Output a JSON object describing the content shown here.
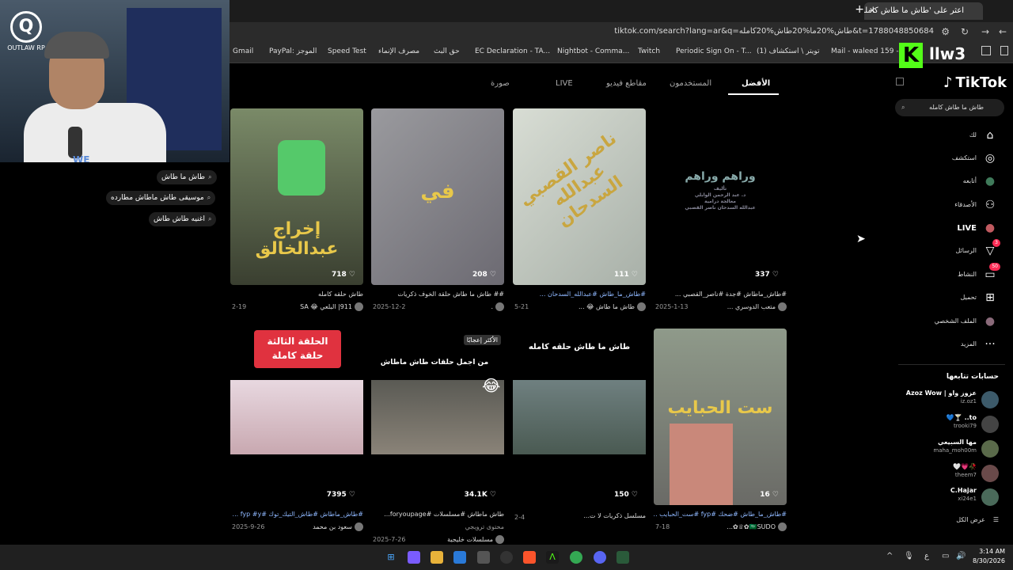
{
  "browser": {
    "tab_title": "اعثر على 'طاش ما طاش كامله' ع",
    "new_tab": "+",
    "tab_close": "×",
    "url": "tiktok.com/search?lang=ar&q=طاش%20ما%20طاش%20كامله&t=1788048850684",
    "bookmarks": [
      "Gmail",
      "PayPal: الموجز",
      "Speed Test",
      "مصرف الإنماء",
      "حق البث",
      "EC Declaration - TA...",
      "Nightbot - Comma...",
      "Twitch",
      "Periodic Sign On - T...",
      "تويتر \\ استكشاف (1)",
      "Mail - waleed 159 -..."
    ]
  },
  "overlay": {
    "kick_k": "K",
    "kick_text": "llw3",
    "logo_letter": "Q",
    "logo_text": "OUTLAW RP",
    "we_text": "WE"
  },
  "suggestions": [
    "طاش ما طاش",
    "موسيقى طاش ماطاش مطارده",
    "اغنيه طاش طاش"
  ],
  "tabs": [
    "الأفضل",
    "المستخدمون",
    "مقاطع فيديو",
    "LIVE",
    "صورة"
  ],
  "videos": [
    {
      "likes": "337",
      "caption": "#طاش_ماطاش #جدة #ناصر_القصبي ...",
      "author": "متعب الدوسري ...",
      "date": "2025-1-13",
      "title": "وراهم وراهم",
      "sub": "تأليف\nد. عبد الرحمن الوابلي\nمعالجة درامية\nعبدالله السدحان   ناصر القصبي"
    },
    {
      "likes": "111",
      "caption": "#طاش_ما_طاش #عبدالله_السدحان ...",
      "author": "طاش ما طاش 😂 ...",
      "date": "5-21",
      "title": "ناصر القصبي عبدالله السدحان"
    },
    {
      "likes": "208",
      "caption": "## طاش ما طاش حلقة الخوف ذكريات",
      "author": ".",
      "date": "2025-12-2",
      "title": "في"
    },
    {
      "likes": "718",
      "caption": "طاش حلقه كامله",
      "author": "911| البلعي 😂 SA",
      "date": "2-19",
      "title": "إخراج عبدالخالق"
    },
    {
      "likes": "16",
      "caption": "#طاش_ما_طاش #ضحك #fyp #ست_الحبايب ...",
      "author": "🇸🇦SUDO✿♕✿...",
      "date": "7-18",
      "title": "ست الحبايب"
    },
    {
      "likes": "150",
      "caption": "مسلسل ذكريات لا ت...",
      "author": "",
      "date": "2-4",
      "title": "طاش ما طاش حلقه كامله"
    },
    {
      "likes": "34.1K",
      "caption": "طاش ماطاش #مسلسلات #foryoupage...",
      "author": "محتوى ترويجي",
      "author2": "مسلسلات خليجية",
      "date": "2025-7-26",
      "badge": "الأكثر إعجابًا",
      "title": "من اجمل حلقات طاش ماطاش"
    },
    {
      "likes": "7395",
      "caption": "#طاش_ماطاش #طاش_التيك_توك #fyp #y ...",
      "author": "سعود بن محمد",
      "date": "2025-9-26",
      "title": "الحلقة الثالثة\nحلقة كاملة"
    }
  ],
  "sidebar": {
    "brand": "TikTok",
    "search_value": "طاش ما طاش كامله",
    "nav": [
      {
        "label": "لك",
        "icon": "⌂"
      },
      {
        "label": "استكشف",
        "icon": "◎"
      },
      {
        "label": "أتابعه",
        "icon": "●"
      },
      {
        "label": "الأصدقاء",
        "icon": "⚇"
      },
      {
        "label": "LIVE",
        "icon": "●"
      },
      {
        "label": "الرسائل",
        "icon": "▽",
        "badge": "3"
      },
      {
        "label": "النشاط",
        "icon": "▭",
        "badge": "50"
      },
      {
        "label": "تحميل",
        "icon": "⊞"
      },
      {
        "label": "الملف الشخصي",
        "icon": "●"
      },
      {
        "label": "المزيد",
        "icon": "···"
      }
    ],
    "following_heading": "حسابات تتابعها",
    "accounts": [
      {
        "name": "عزوز واو | Azoz Wow",
        "handle": "iz.oz1"
      },
      {
        "name": "to.. 🍸💙",
        "handle": "trooki79"
      },
      {
        "name": "مها السبيعي",
        "handle": "maha_moh00m"
      },
      {
        "name": "🥀💗🤍",
        "handle": "theem7"
      },
      {
        "name": "C.Hajar",
        "handle": "xi24e1"
      }
    ],
    "see_all": "عرض الكل"
  },
  "taskbar": {
    "time": "3:14 AM",
    "date": "8/30/2026",
    "lang": "ع"
  }
}
